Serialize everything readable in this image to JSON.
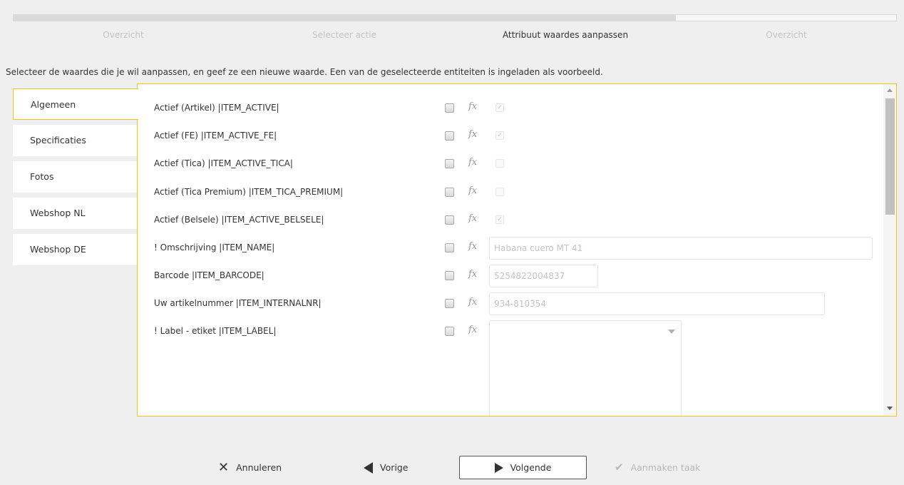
{
  "wizard": {
    "progress": 0.75,
    "steps": [
      {
        "label": "Overzicht",
        "active": false
      },
      {
        "label": "Selecteer actie",
        "active": false
      },
      {
        "label": "Attribuut waardes aanpassen",
        "active": true
      },
      {
        "label": "Overzicht",
        "active": false
      }
    ]
  },
  "intro_text": "Selecteer de waardes die je wil aanpassen, en geef ze een nieuwe waarde. Een van de geselecteerde entiteiten is ingeladen als voorbeeld.",
  "tabs": [
    {
      "label": "Algemeen",
      "active": true
    },
    {
      "label": "Specificaties",
      "active": false
    },
    {
      "label": "Fotos",
      "active": false
    },
    {
      "label": "Webshop NL",
      "active": false
    },
    {
      "label": "Webshop DE",
      "active": false
    }
  ],
  "fx_symbol": "fx",
  "attributes": [
    {
      "label": "Actief (Artikel) |ITEM_ACTIVE|",
      "value_type": "checkbox",
      "value_checked": true
    },
    {
      "label": "Actief (FE) |ITEM_ACTIVE_FE|",
      "value_type": "checkbox",
      "value_checked": true
    },
    {
      "label": "Actief (Tica) |ITEM_ACTIVE_TICA|",
      "value_type": "checkbox",
      "value_checked": false
    },
    {
      "label": "Actief (Tica Premium) |ITEM_TICA_PREMIUM|",
      "value_type": "checkbox",
      "value_checked": false
    },
    {
      "label": "Actief (Belsele) |ITEM_ACTIVE_BELSELE|",
      "value_type": "checkbox",
      "value_checked": true
    },
    {
      "label": "! Omschrijving |ITEM_NAME|",
      "value_type": "text",
      "value": "Habana cuero MT 41"
    },
    {
      "label": "Barcode |ITEM_BARCODE|",
      "value_type": "text",
      "value": "5254822004837"
    },
    {
      "label": "Uw artikelnummer |ITEM_INTERNALNR|",
      "value_type": "text",
      "value": "934-810354"
    },
    {
      "label": "! Label - etiket |ITEM_LABEL|",
      "value_type": "select",
      "value": ""
    }
  ],
  "footer": {
    "cancel_label": "Annuleren",
    "previous_label": "Vorige",
    "next_label": "Volgende",
    "create_task_label": "Aanmaken taak"
  },
  "colors": {
    "accent": "#f2c318",
    "background": "#efefef"
  }
}
